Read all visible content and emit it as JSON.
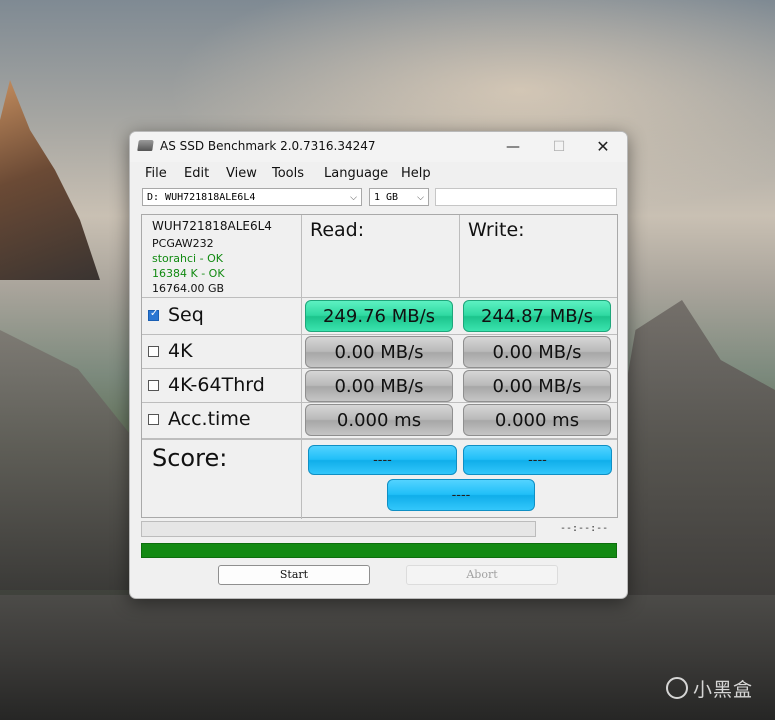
{
  "window": {
    "title": "AS SSD Benchmark 2.0.7316.34247",
    "minimize_glyph": "—",
    "maximize_glyph": "☐",
    "close_glyph": "✕"
  },
  "menu": {
    "items": [
      "File",
      "Edit",
      "View",
      "Tools",
      "Language",
      "Help"
    ]
  },
  "drive_select": {
    "value": "D: WUH721818ALE6L4"
  },
  "size_select": {
    "value": "1 GB"
  },
  "drive_info": {
    "model": "WUH721818ALE6L4",
    "firmware": "PCGAW232",
    "driver_status": "storahci - OK",
    "alignment_status": "16384 K - OK",
    "capacity": "16764.00 GB"
  },
  "columns": {
    "read": "Read:",
    "write": "Write:"
  },
  "tests": [
    {
      "label": "Seq",
      "checked": true,
      "read": "249.76 MB/s",
      "write": "244.87 MB/s"
    },
    {
      "label": "4K",
      "checked": false,
      "read": "0.00 MB/s",
      "write": "0.00 MB/s"
    },
    {
      "label": "4K-64Thrd",
      "checked": false,
      "read": "0.00 MB/s",
      "write": "0.00 MB/s"
    },
    {
      "label": "Acc.time",
      "checked": false,
      "read": "0.000 ms",
      "write": "0.000 ms"
    }
  ],
  "score": {
    "label": "Score:",
    "read": "----",
    "write": "----",
    "total": "----"
  },
  "progress": {
    "time": "--:--:--"
  },
  "buttons": {
    "start": "Start",
    "abort": "Abort"
  },
  "watermark": {
    "text": "小黑盒"
  },
  "colors": {
    "result_active": "#2fd9a1",
    "result_inactive": "#b9b9b9",
    "score": "#20bff8",
    "status_bar": "#138a13",
    "ok_text": "#118a11"
  }
}
